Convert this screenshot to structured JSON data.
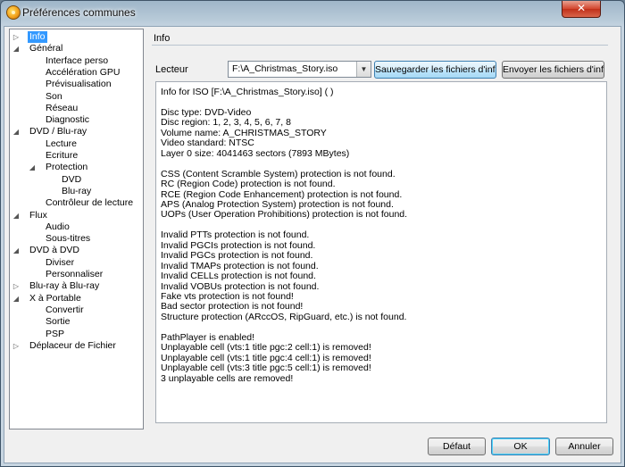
{
  "window": {
    "title": "Préférences communes",
    "close_glyph": "✕"
  },
  "tree": {
    "items": [
      {
        "label": "Info",
        "level": 0,
        "arrow": "▷",
        "selected": true
      },
      {
        "label": "Général",
        "level": 0,
        "arrow": "◢"
      },
      {
        "label": "Interface perso",
        "level": 1
      },
      {
        "label": "Accélération GPU",
        "level": 1
      },
      {
        "label": "Prévisualisation",
        "level": 1
      },
      {
        "label": "Son",
        "level": 1
      },
      {
        "label": "Réseau",
        "level": 1
      },
      {
        "label": "Diagnostic",
        "level": 1
      },
      {
        "label": "DVD / Blu-ray",
        "level": 0,
        "arrow": "◢"
      },
      {
        "label": "Lecture",
        "level": 1
      },
      {
        "label": "Ecriture",
        "level": 1
      },
      {
        "label": "Protection",
        "level": 1,
        "arrow": "◢"
      },
      {
        "label": "DVD",
        "level": 2
      },
      {
        "label": "Blu-ray",
        "level": 2
      },
      {
        "label": "Contrôleur de lecture",
        "level": 1
      },
      {
        "label": "Flux",
        "level": 0,
        "arrow": "◢"
      },
      {
        "label": "Audio",
        "level": 1
      },
      {
        "label": "Sous-titres",
        "level": 1
      },
      {
        "label": "DVD à DVD",
        "level": 0,
        "arrow": "◢"
      },
      {
        "label": "Diviser",
        "level": 1
      },
      {
        "label": "Personnaliser",
        "level": 1
      },
      {
        "label": "Blu-ray à Blu-ray",
        "level": 0,
        "arrow": "▷"
      },
      {
        "label": "X à Portable",
        "level": 0,
        "arrow": "◢"
      },
      {
        "label": "Convertir",
        "level": 1
      },
      {
        "label": "Sortie",
        "level": 1
      },
      {
        "label": "PSP",
        "level": 1
      },
      {
        "label": "Déplaceur de Fichier",
        "level": 0,
        "arrow": "▷"
      }
    ]
  },
  "section_title": "Info",
  "lecteur": {
    "label": "Lecteur",
    "value": "F:\\A_Christmas_Story.iso",
    "arrow": "▼"
  },
  "buttons": {
    "save_info": "Sauvegarder les fichiers d'infos",
    "send_info": "Envoyer les fichiers d'infos",
    "default": "Défaut",
    "ok": "OK",
    "cancel": "Annuler"
  },
  "info_lines": [
    "Info for ISO [F:\\A_Christmas_Story.iso] ( )",
    "",
    "Disc type: DVD-Video",
    "Disc region: 1, 2, 3, 4, 5, 6, 7, 8",
    "Volume name: A_CHRISTMAS_STORY",
    "Video standard: NTSC",
    "Layer 0 size: 4041463 sectors (7893 MBytes)",
    "",
    "CSS (Content Scramble System) protection is not found.",
    "RC (Region Code) protection is not found.",
    "RCE (Region Code Enhancement) protection is not found.",
    "APS (Analog Protection System) protection is not found.",
    "UOPs (User Operation Prohibitions) protection is not found.",
    "",
    "Invalid PTTs protection is not found.",
    "Invalid PGCIs protection is not found.",
    "Invalid PGCs protection is not found.",
    "Invalid TMAPs protection is not found.",
    "Invalid CELLs protection is not found.",
    "Invalid VOBUs protection is not found.",
    "Fake vts protection is not found!",
    "Bad sector protection is not found!",
    "Structure protection (ARccOS, RipGuard, etc.) is not found.",
    "",
    "PathPlayer is enabled!",
    "Unplayable cell (vts:1 title pgc:2 cell:1) is removed!",
    "Unplayable cell (vts:1 title pgc:4 cell:1) is removed!",
    "Unplayable cell (vts:3 title pgc:5 cell:1) is removed!",
    "3 unplayable cells are removed!"
  ]
}
